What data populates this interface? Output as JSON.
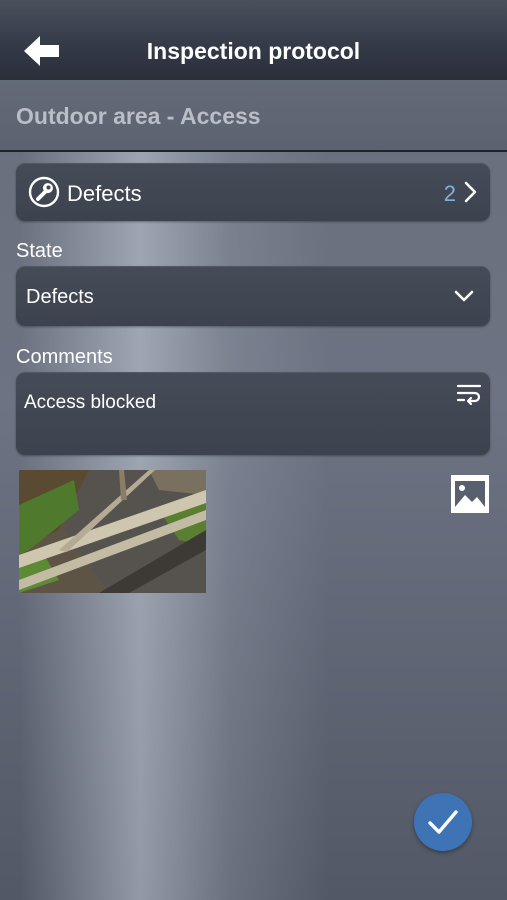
{
  "header": {
    "title": "Inspection protocol",
    "back_icon": "back-arrow-icon"
  },
  "section": {
    "title": "Outdoor area - Access"
  },
  "defects": {
    "label": "Defects",
    "count": "2",
    "icon": "wrench-icon"
  },
  "state": {
    "label": "State",
    "value": "Defects"
  },
  "comments": {
    "label": "Comments",
    "value": "Access blocked"
  },
  "photo": {
    "icon": "image-icon"
  },
  "confirm": {
    "icon": "checkmark-icon",
    "color": "#3e73b6"
  }
}
